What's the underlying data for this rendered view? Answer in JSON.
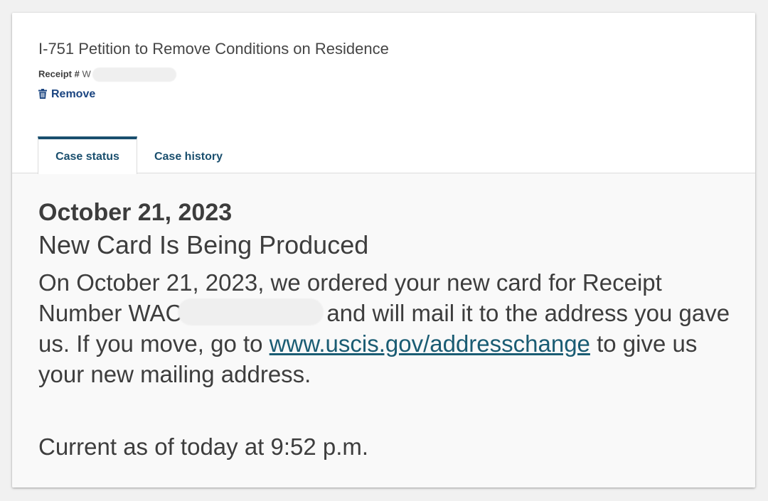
{
  "case": {
    "form_title": "I-751 Petition to Remove Conditions on Residence",
    "receipt_label": "Receipt #",
    "receipt_number_visible": "W",
    "remove_label": "Remove"
  },
  "tabs": [
    {
      "label": "Case status",
      "active": true
    },
    {
      "label": "Case history",
      "active": false
    }
  ],
  "status": {
    "date": "October 21, 2023",
    "title": "New Card Is Being Produced",
    "message_part1": "On October 21, 2023, we ordered your new card for Receipt Number WAC",
    "message_part2": "and will mail it to the address you gave us. If you move, go to",
    "link_text": "www.uscis.gov/addresschange",
    "message_part3": "to give us your new mailing address.",
    "current_as_of": "Current as of today at 9:52 p.m."
  },
  "colors": {
    "accent": "#1a4f6e",
    "link": "#1a5c73",
    "text": "#3d3d3d"
  },
  "icons": {
    "remove": "trash-icon"
  }
}
